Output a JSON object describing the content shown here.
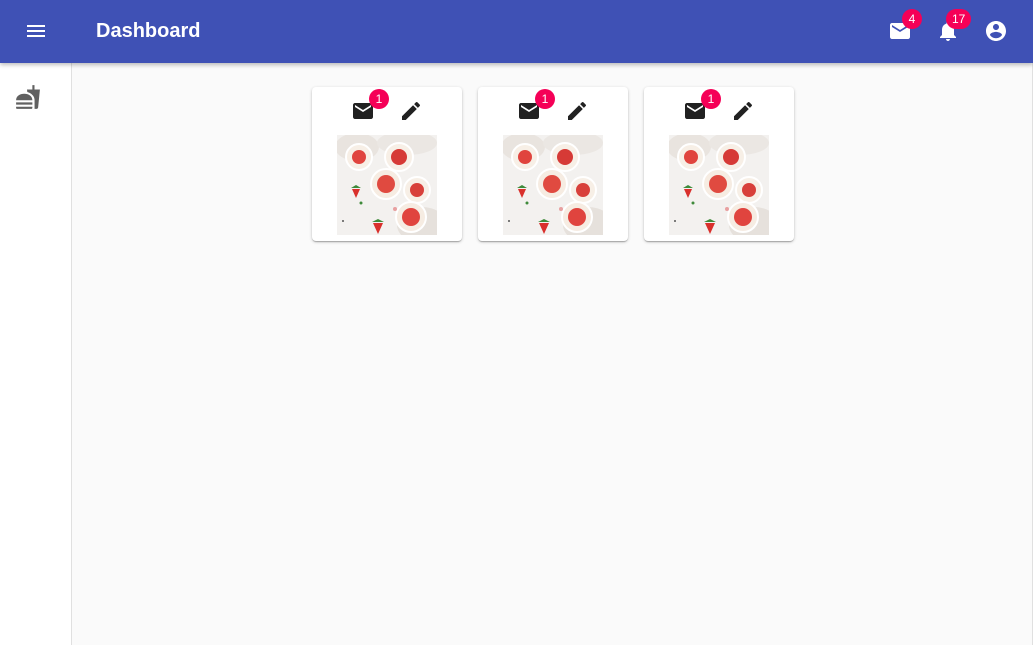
{
  "appbar": {
    "title": "Dashboard",
    "mail_badge": "4",
    "notifications_badge": "17",
    "icons": [
      "menu-icon",
      "mail-icon",
      "bell-icon",
      "account-circle-icon"
    ],
    "color": "#3f51b5"
  },
  "drawer": {
    "items": [
      {
        "icon": "fastfood-icon"
      }
    ]
  },
  "cards": [
    {
      "mail_badge": "1",
      "image": "strawberry-dessert-image"
    },
    {
      "mail_badge": "1",
      "image": "strawberry-dessert-image"
    },
    {
      "mail_badge": "1",
      "image": "strawberry-dessert-image"
    }
  ],
  "colors": {
    "badge": "#f50057",
    "background": "#fafafa"
  }
}
